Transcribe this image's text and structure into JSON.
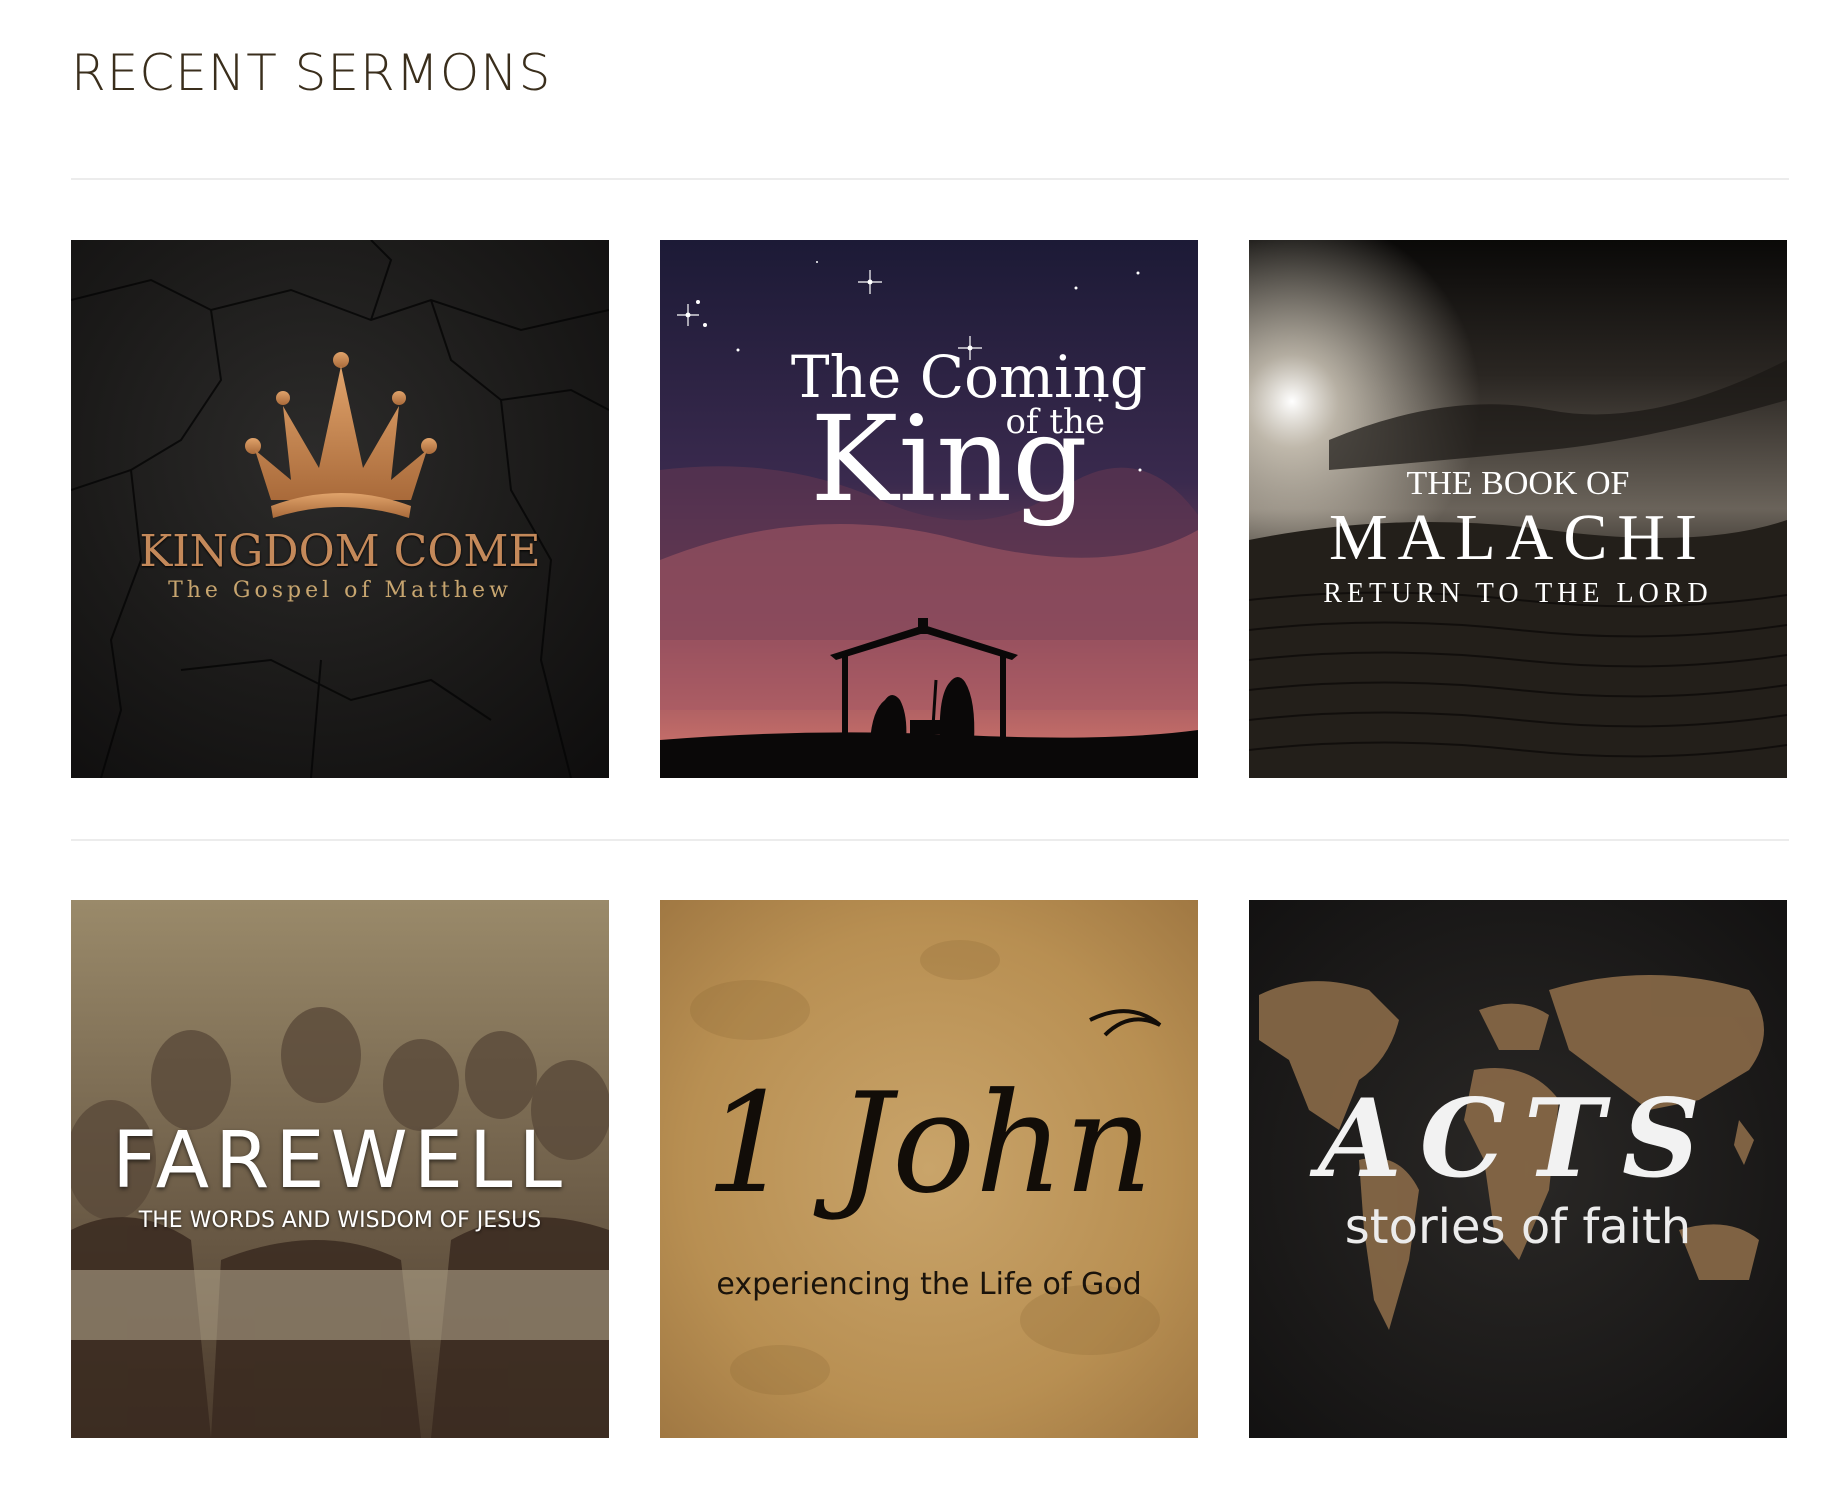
{
  "section": {
    "title": "RECENT SERMONS"
  },
  "sermons": [
    {
      "title": "KINGDOM COME",
      "subtitle": "The Gospel of Matthew",
      "icon": "crown-icon",
      "colors": {
        "title": "#c4895a",
        "subtitle": "#c7a56f"
      }
    },
    {
      "title_line1": "The Coming",
      "title_line2": "of the",
      "title_line3": "King",
      "icon": "nativity-icon"
    },
    {
      "pretitle": "THE BOOK OF",
      "title": "MALACHI",
      "subtitle": "RETURN TO THE LORD"
    },
    {
      "title": "FAREWELL",
      "subtitle": "THE WORDS AND WISDOM OF JESUS"
    },
    {
      "title": "1 John",
      "subtitle": "experiencing the Life of God"
    },
    {
      "title": "ACTS",
      "subtitle": "stories of faith",
      "icon": "world-map-icon"
    }
  ]
}
